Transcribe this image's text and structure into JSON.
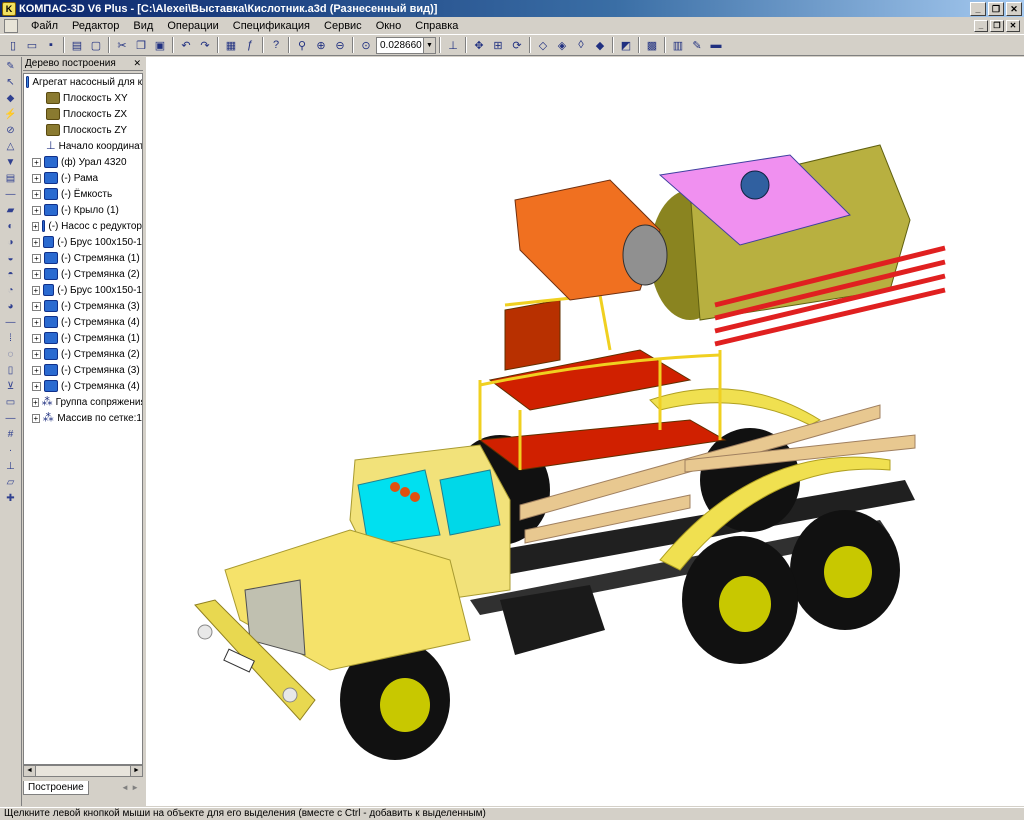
{
  "window": {
    "title": "КОМПАС-3D V6 Plus - [C:\\Alexei\\Выставка\\Кислотник.a3d (Разнесенный вид)]",
    "buttons": {
      "minimize": "_",
      "restore": "❐",
      "close": "✕"
    }
  },
  "menu": {
    "items": [
      "Файл",
      "Редактор",
      "Вид",
      "Операции",
      "Спецификация",
      "Сервис",
      "Окно",
      "Справка"
    ]
  },
  "toolbar": {
    "zoom_value": "0.028660"
  },
  "tree_panel": {
    "title": "Дерево построения",
    "close": "✕",
    "root": "Агрегат насосный для к",
    "items": [
      {
        "label": "Плоскость XY",
        "type": "plane",
        "expand": ""
      },
      {
        "label": "Плоскость ZX",
        "type": "plane",
        "expand": ""
      },
      {
        "label": "Плоскость ZY",
        "type": "plane",
        "expand": ""
      },
      {
        "label": "Начало координат",
        "type": "origin",
        "expand": ""
      },
      {
        "label": "(ф) Урал 4320",
        "type": "comp",
        "expand": "+"
      },
      {
        "label": "(-) Рама",
        "type": "comp",
        "expand": "+"
      },
      {
        "label": "(-) Ёмкость",
        "type": "comp",
        "expand": "+"
      },
      {
        "label": "(-) Крыло (1)",
        "type": "comp",
        "expand": "+"
      },
      {
        "label": "(-) Насос с редуктор",
        "type": "comp",
        "expand": "+"
      },
      {
        "label": "(-) Брус 100х150-1",
        "type": "comp",
        "expand": "+"
      },
      {
        "label": "(-) Стремянка (1)",
        "type": "comp",
        "expand": "+"
      },
      {
        "label": "(-) Стремянка (2)",
        "type": "comp",
        "expand": "+"
      },
      {
        "label": "(-) Брус 100х150-1",
        "type": "comp",
        "expand": "+"
      },
      {
        "label": "(-) Стремянка (3)",
        "type": "comp",
        "expand": "+"
      },
      {
        "label": "(-) Стремянка (4)",
        "type": "comp",
        "expand": "+"
      },
      {
        "label": "(-) Стремянка (1)",
        "type": "comp",
        "expand": "+"
      },
      {
        "label": "(-) Стремянка (2)",
        "type": "comp",
        "expand": "+"
      },
      {
        "label": "(-) Стремянка (3)",
        "type": "comp",
        "expand": "+"
      },
      {
        "label": "(-) Стремянка (4)",
        "type": "comp",
        "expand": "+"
      },
      {
        "label": "Группа сопряжения",
        "type": "group",
        "expand": "+"
      },
      {
        "label": "Массив по сетке:1",
        "type": "group",
        "expand": "+"
      }
    ],
    "tab": "Построение"
  },
  "status": {
    "text": "Щелкните левой кнопкой мыши на объекте для его выделения (вместе с Ctrl - добавить к выделенным)"
  },
  "colors": {
    "title_start": "#0a246a",
    "truck_yellow": "#f5e26a",
    "tank_olive": "#b8b040",
    "pump_orange": "#f08030",
    "rails_red": "#e02020",
    "platform_magenta": "#e080f0"
  }
}
